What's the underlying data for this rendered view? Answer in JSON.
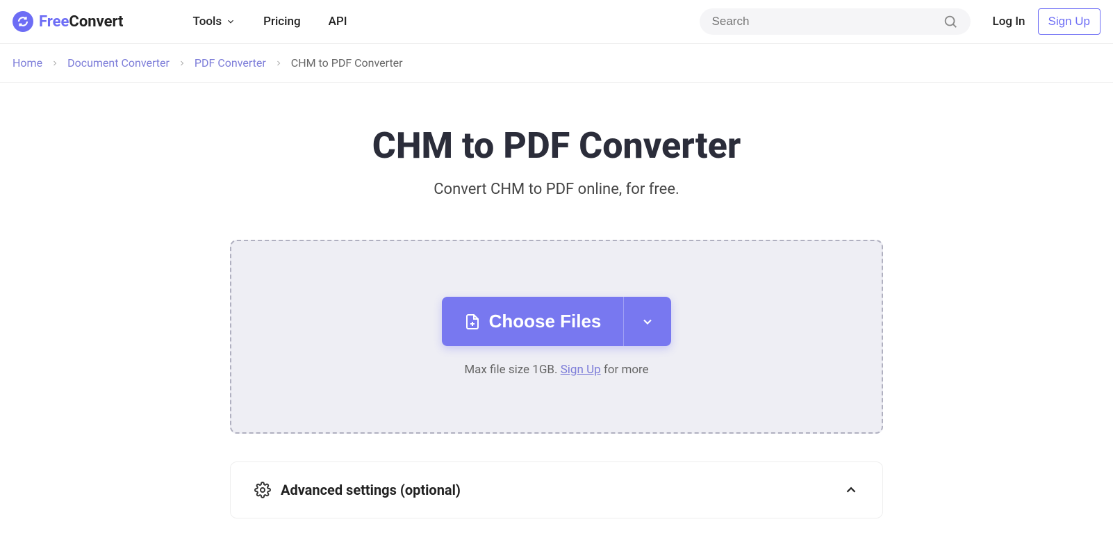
{
  "logo": {
    "free": "Free",
    "convert": "Convert"
  },
  "nav": {
    "tools": "Tools",
    "pricing": "Pricing",
    "api": "API"
  },
  "search": {
    "placeholder": "Search"
  },
  "auth": {
    "login": "Log In",
    "signup": "Sign Up"
  },
  "breadcrumbs": {
    "home": "Home",
    "doc": "Document Converter",
    "pdf": "PDF Converter",
    "current": "CHM to PDF Converter"
  },
  "page": {
    "title": "CHM to PDF Converter",
    "subtitle": "Convert CHM to PDF online, for free."
  },
  "dropzone": {
    "choose": "Choose Files",
    "note_prefix": "Max file size 1GB. ",
    "note_link": "Sign Up",
    "note_suffix": " for more"
  },
  "advanced": {
    "label": "Advanced settings (optional)"
  }
}
